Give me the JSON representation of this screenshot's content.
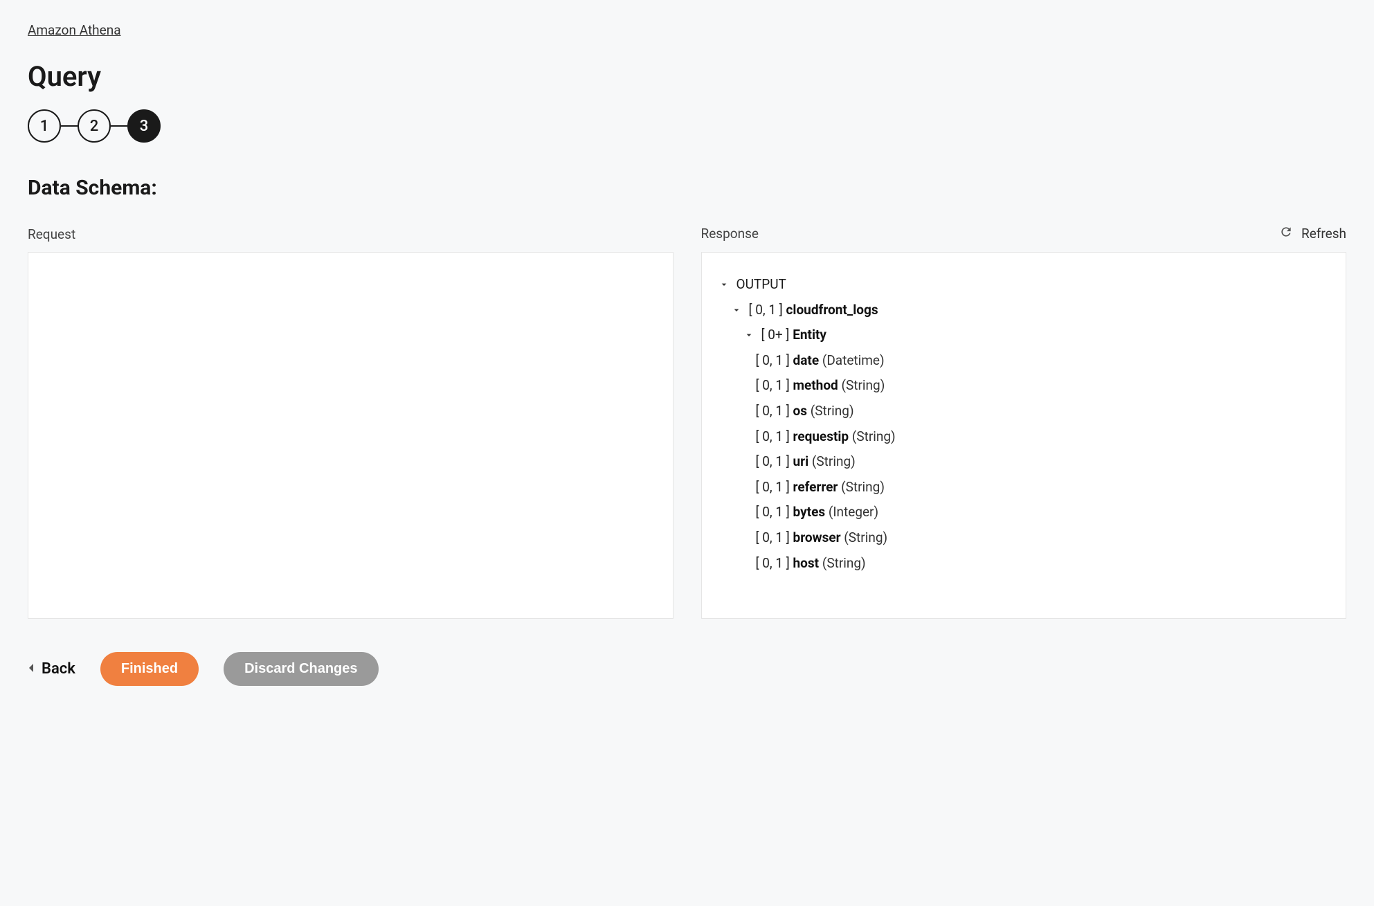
{
  "breadcrumb": "Amazon Athena",
  "title": "Query",
  "steps": [
    "1",
    "2",
    "3"
  ],
  "active_step_index": 2,
  "section": "Data Schema:",
  "request_label": "Request",
  "response_label": "Response",
  "refresh_label": "Refresh",
  "tree": {
    "root": "OUTPUT",
    "node1_card": "[ 0, 1 ]",
    "node1_name": "cloudfront_logs",
    "node2_card": "[ 0+ ]",
    "node2_name": "Entity",
    "fields": [
      {
        "card": "[ 0, 1 ]",
        "name": "date",
        "type": "(Datetime)"
      },
      {
        "card": "[ 0, 1 ]",
        "name": "method",
        "type": "(String)"
      },
      {
        "card": "[ 0, 1 ]",
        "name": "os",
        "type": "(String)"
      },
      {
        "card": "[ 0, 1 ]",
        "name": "requestip",
        "type": "(String)"
      },
      {
        "card": "[ 0, 1 ]",
        "name": "uri",
        "type": "(String)"
      },
      {
        "card": "[ 0, 1 ]",
        "name": "referrer",
        "type": "(String)"
      },
      {
        "card": "[ 0, 1 ]",
        "name": "bytes",
        "type": "(Integer)"
      },
      {
        "card": "[ 0, 1 ]",
        "name": "browser",
        "type": "(String)"
      },
      {
        "card": "[ 0, 1 ]",
        "name": "host",
        "type": "(String)"
      }
    ]
  },
  "buttons": {
    "back": "Back",
    "finished": "Finished",
    "discard": "Discard Changes"
  }
}
